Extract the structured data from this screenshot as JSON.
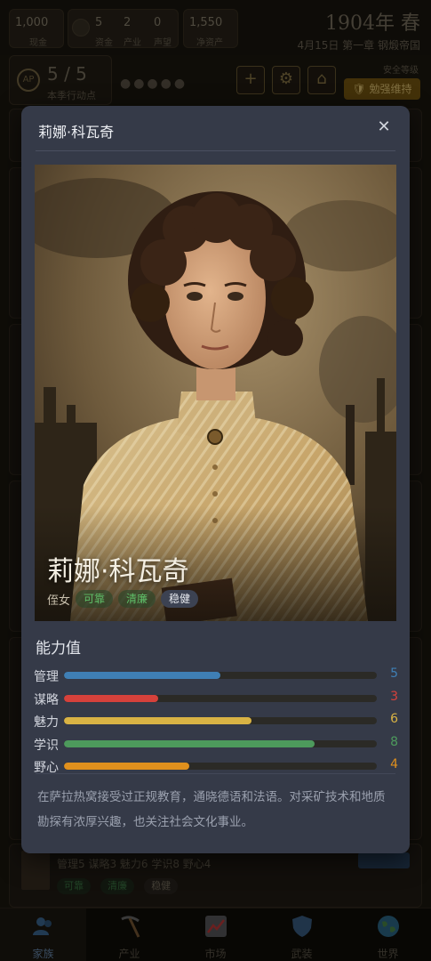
{
  "topbar": {
    "resources": [
      {
        "icon": "money-bag-icon",
        "value": "1,000",
        "label": "现金"
      },
      {
        "icon": "coin-icon",
        "value": "5",
        "label": "资金"
      },
      {
        "icon": "pickaxe-icon",
        "value": "2",
        "label": "产业"
      },
      {
        "icon": "star-icon",
        "value": "0",
        "label": "声望"
      },
      {
        "icon": "bank-icon",
        "value": "1,550",
        "label": "净资产"
      }
    ],
    "year": "1904年 春",
    "date_line": "4月15日  第一章  钢煅帝国"
  },
  "action_points": {
    "badge": "AP",
    "value": "5 / 5",
    "label": "本季行动点",
    "dots": "●●●●●"
  },
  "toolbar": {
    "add_label": "+",
    "safe_label": "安全等级",
    "maintain_label": "🛡 勉强维持"
  },
  "background_card": {
    "stats_line": "管理5 谋略3 魅力6 学识8 野心4",
    "tags": [
      "可靠",
      "清廉",
      "稳健"
    ]
  },
  "bottom_nav": [
    {
      "label": "家族",
      "icon": "family-icon",
      "active": true
    },
    {
      "label": "产业",
      "icon": "pickaxe-icon",
      "active": false
    },
    {
      "label": "市场",
      "icon": "market-chart-icon",
      "active": false
    },
    {
      "label": "武装",
      "icon": "shield-icon",
      "active": false
    },
    {
      "label": "世界",
      "icon": "globe-icon",
      "active": false
    }
  ],
  "modal": {
    "title": "莉娜·科瓦奇",
    "close": "✕",
    "character_name": "莉娜·科瓦奇",
    "tag_prefix": "侄女",
    "tags": [
      {
        "text": "可靠",
        "style": "green"
      },
      {
        "text": "清廉",
        "style": "green"
      },
      {
        "text": "稳健",
        "style": "neutral"
      }
    ],
    "section_title": "能力值",
    "max_stat": 10,
    "stats": [
      {
        "label": "管理",
        "value": 5,
        "color": "#3f7fb5"
      },
      {
        "label": "谋略",
        "value": 3,
        "color": "#d6413b"
      },
      {
        "label": "魅力",
        "value": 6,
        "color": "#d9b344"
      },
      {
        "label": "学识",
        "value": 8,
        "color": "#4d9a5c"
      },
      {
        "label": "野心",
        "value": 4,
        "color": "#e0901d"
      }
    ],
    "description": "在萨拉热窝接受过正规教育，通晓德语和法语。对采矿技术和地质勘探有浓厚兴趣，也关注社会文化事业。"
  }
}
